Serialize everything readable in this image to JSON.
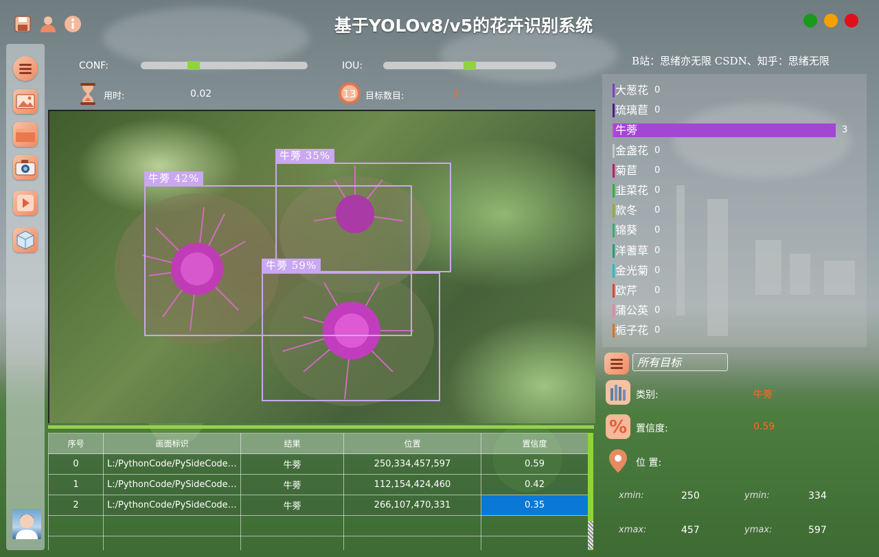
{
  "app": {
    "title": "基于YOLOv8/v5的花卉识别系统"
  },
  "toolbar": {
    "icons": [
      "save-icon",
      "user-icon",
      "info-icon"
    ]
  },
  "window_controls": {
    "colors": [
      "#1a9a1a",
      "#f2a100",
      "#e0101a"
    ]
  },
  "sidebar": {
    "items": [
      "menu-icon",
      "image-icon",
      "folder-icon",
      "camera-icon",
      "video-icon",
      "model-icon"
    ]
  },
  "params": {
    "conf_label": "CONF:",
    "conf_value": 0.3,
    "iou_label": "IOU:",
    "iou_value": 0.5,
    "time_label": "用时:",
    "time_value": "0.02",
    "count_label": "目标数目:",
    "count_value": "3"
  },
  "credit": "B站：思绪亦无限  CSDN、知乎：思绪无限",
  "detections": [
    {
      "label": "牛蒡  42%"
    },
    {
      "label": "牛蒡  35%"
    },
    {
      "label": "牛蒡  59%"
    }
  ],
  "table": {
    "headers": [
      "序号",
      "画面标识",
      "结果",
      "位置",
      "置信度"
    ],
    "rows": [
      [
        "0",
        "L:/PythonCode/PySideCode/...",
        "牛蒡",
        "250,334,457,597",
        "0.59"
      ],
      [
        "1",
        "L:/PythonCode/PySideCode/...",
        "牛蒡",
        "112,154,424,460",
        "0.42"
      ],
      [
        "2",
        "L:/PythonCode/PySideCode/...",
        "牛蒡",
        "266,107,470,331",
        "0.35"
      ]
    ],
    "selected": "0.35"
  },
  "chart_data": {
    "type": "bar",
    "categories": [
      "大葱花",
      "琉璃苣",
      "牛蒡",
      "金盏花",
      "菊苣",
      "韭菜花",
      "款冬",
      "锦葵",
      "洋蓍草",
      "金光菊",
      "欧芹",
      "蒲公英",
      "栀子花"
    ],
    "values": [
      0,
      0,
      3,
      0,
      0,
      0,
      0,
      0,
      0,
      0,
      0,
      0,
      0
    ],
    "bar_color": "#a446d4",
    "accent_colors": [
      "#7b3fc4",
      "#4a1a8a",
      "#b84ad6",
      "#c8c8d0",
      "#c0186c",
      "#30b040",
      "#8ab030",
      "#30b070",
      "#20a070",
      "#20c0c0",
      "#e04030",
      "#f080a0",
      "#e07020"
    ]
  },
  "filter": {
    "placeholder": "所有目标"
  },
  "info": {
    "class_label": "类别:",
    "class_value": "牛蒡",
    "conf_label": "置信度:",
    "conf_value": "0.59",
    "pos_label": "位 置:",
    "xmin_label": "xmin:",
    "xmin": "250",
    "ymin_label": "ymin:",
    "ymin": "334",
    "xmax_label": "xmax:",
    "xmax": "457",
    "ymax_label": "ymax:",
    "ymax": "597"
  }
}
